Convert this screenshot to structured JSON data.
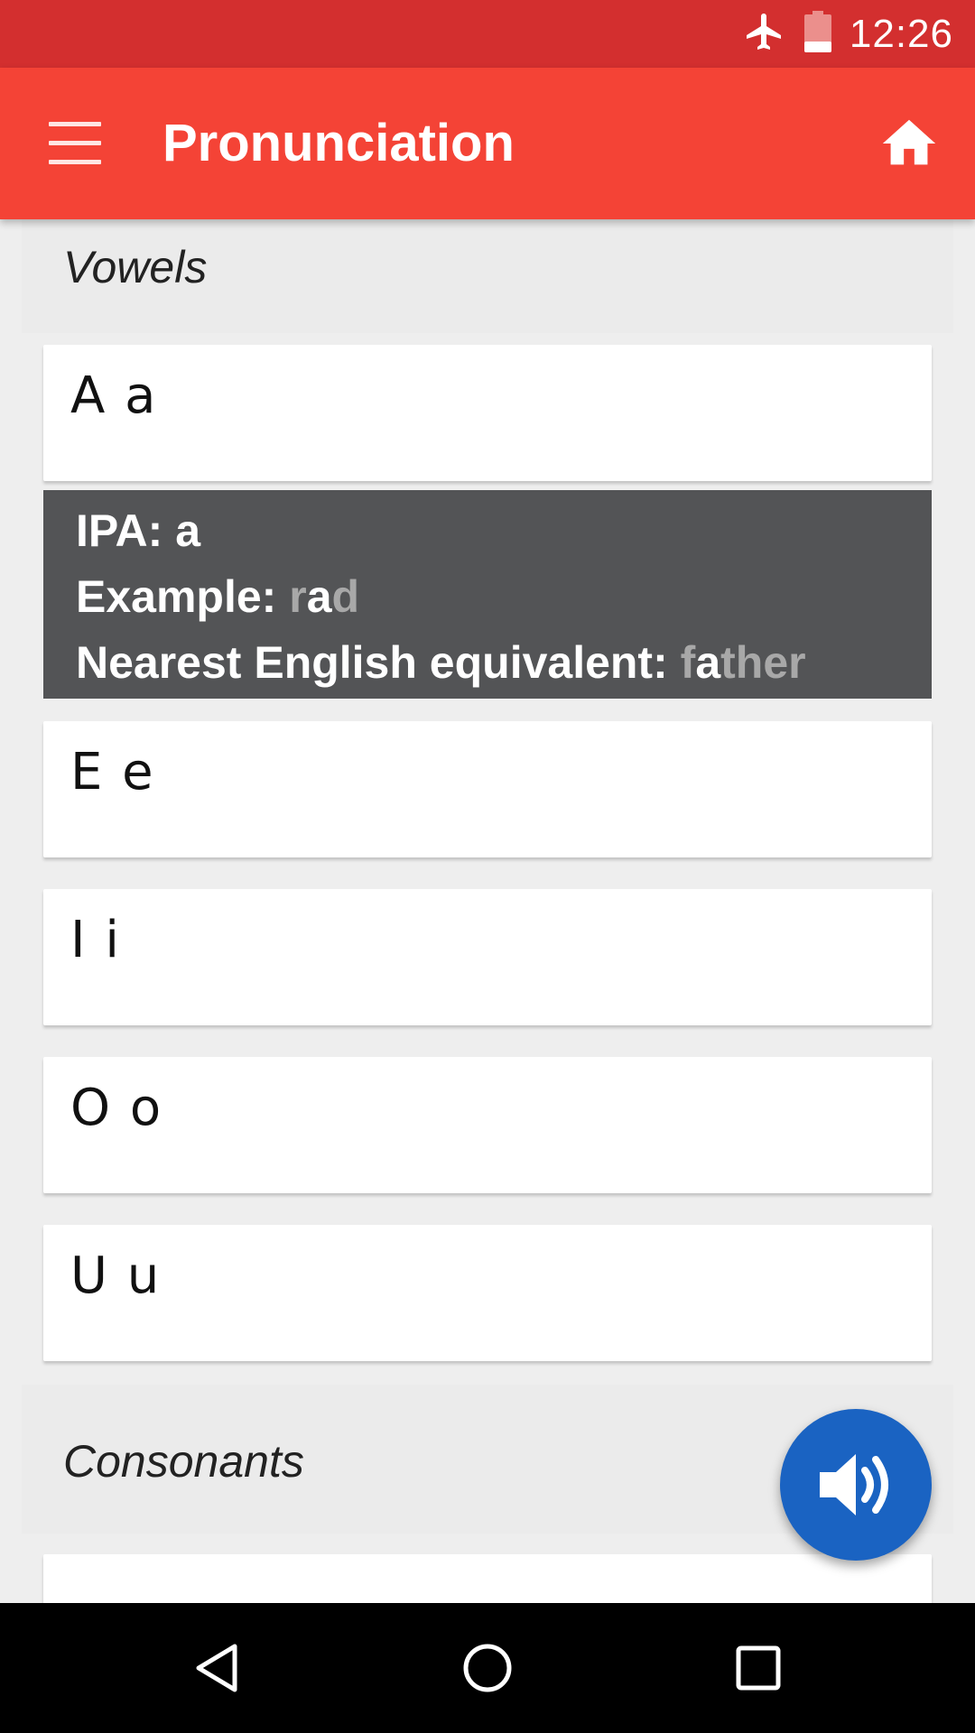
{
  "status_bar": {
    "time": "12:26",
    "icons": [
      "airplane-mode-icon",
      "battery-icon"
    ]
  },
  "app_bar": {
    "title": "Pronunciation",
    "menu_icon": "hamburger-menu-icon",
    "home_icon": "home-icon"
  },
  "vowels": {
    "title": "Vowels",
    "items": [
      "A a",
      "E e",
      "I i",
      "O o",
      "U u"
    ]
  },
  "detail": {
    "ipa_label": "IPA:",
    "ipa_value": "a",
    "example_label": "Example:",
    "example_before": "r",
    "example_highlight": "a",
    "example_after": "d",
    "equivalent_label": "Nearest English equivalent:",
    "equivalent_before": "f",
    "equivalent_highlight": "a",
    "equivalent_after": "ther"
  },
  "consonants": {
    "title": "Consonants"
  },
  "fab": {
    "icon": "speaker-volume-icon"
  },
  "nav_bar": {
    "icons": [
      "back-icon",
      "home-circle-icon",
      "recents-icon"
    ]
  },
  "colors": {
    "status_bar": "#d32f2f",
    "app_bar": "#f44336",
    "fab": "#1a63c2",
    "detail_bg": "#535456",
    "highlight_dim": "#a8a8a8"
  }
}
